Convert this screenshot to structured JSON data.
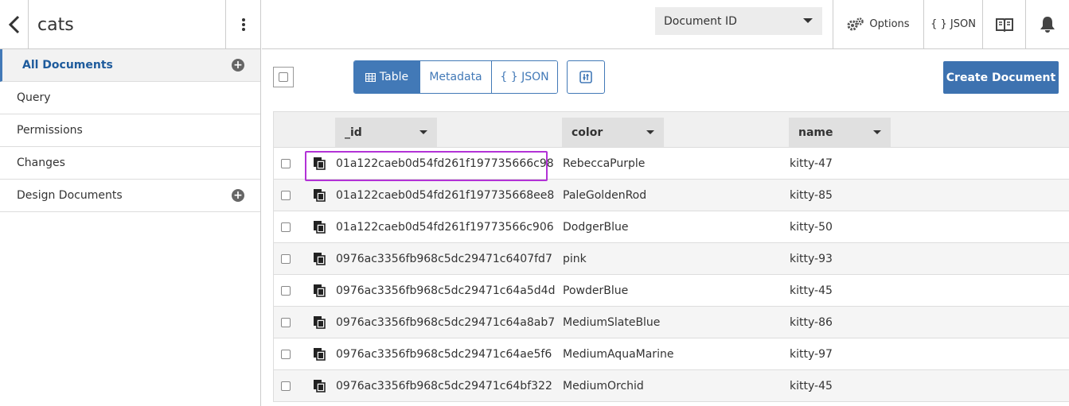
{
  "sidebar": {
    "db_name": "cats",
    "items": [
      {
        "label": "All Documents",
        "active": true,
        "has_add": true
      },
      {
        "label": "Query",
        "active": false,
        "has_add": false
      },
      {
        "label": "Permissions",
        "active": false,
        "has_add": false
      },
      {
        "label": "Changes",
        "active": false,
        "has_add": false
      },
      {
        "label": "Design Documents",
        "active": false,
        "has_add": true
      }
    ]
  },
  "header": {
    "index_select": "Document ID",
    "options_label": "Options",
    "json_label": "{ } JSON"
  },
  "toolbar": {
    "view_table": "Table",
    "view_metadata": "Metadata",
    "view_json": "{ } JSON",
    "create_label": "Create Document"
  },
  "table": {
    "columns": [
      "_id",
      "color",
      "name"
    ],
    "rows": [
      {
        "id": "01a122caeb0d54fd261f197735666c98",
        "color": "RebeccaPurple",
        "name": "kitty-47"
      },
      {
        "id": "01a122caeb0d54fd261f197735668ee8",
        "color": "PaleGoldenRod",
        "name": "kitty-85"
      },
      {
        "id": "01a122caeb0d54fd261f19773566c906",
        "color": "DodgerBlue",
        "name": "kitty-50"
      },
      {
        "id": "0976ac3356fb968c5dc29471c6407fd7",
        "color": "pink",
        "name": "kitty-93"
      },
      {
        "id": "0976ac3356fb968c5dc29471c64a5d4d",
        "color": "PowderBlue",
        "name": "kitty-45"
      },
      {
        "id": "0976ac3356fb968c5dc29471c64a8ab7",
        "color": "MediumSlateBlue",
        "name": "kitty-86"
      },
      {
        "id": "0976ac3356fb968c5dc29471c64ae5f6",
        "color": "MediumAquaMarine",
        "name": "kitty-97"
      },
      {
        "id": "0976ac3356fb968c5dc29471c64bf322",
        "color": "MediumOrchid",
        "name": "kitty-45"
      }
    ]
  },
  "colors": {
    "accent": "#4279b7",
    "primary_button": "#3d72b0",
    "highlight_border": "#b232d6"
  }
}
